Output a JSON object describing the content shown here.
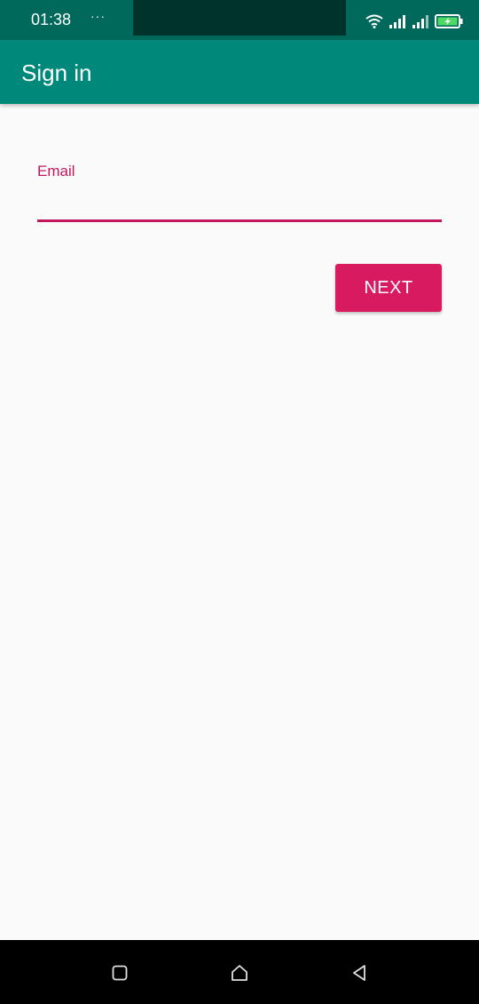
{
  "status_bar": {
    "time": "01:38",
    "more": "···",
    "icons": [
      "wifi-icon",
      "signal-icon",
      "signal-icon",
      "battery-charging-icon"
    ]
  },
  "app_bar": {
    "title": "Sign in"
  },
  "form": {
    "email_label": "Email",
    "email_value": "",
    "next_label": "NEXT"
  },
  "nav_bar": {
    "icons": [
      "recents-icon",
      "home-icon",
      "back-icon"
    ]
  },
  "colors": {
    "status_bar": "#00695c",
    "app_bar": "#00897b",
    "accent": "#d81b60",
    "label": "#c2185b",
    "background": "#fafafa"
  }
}
